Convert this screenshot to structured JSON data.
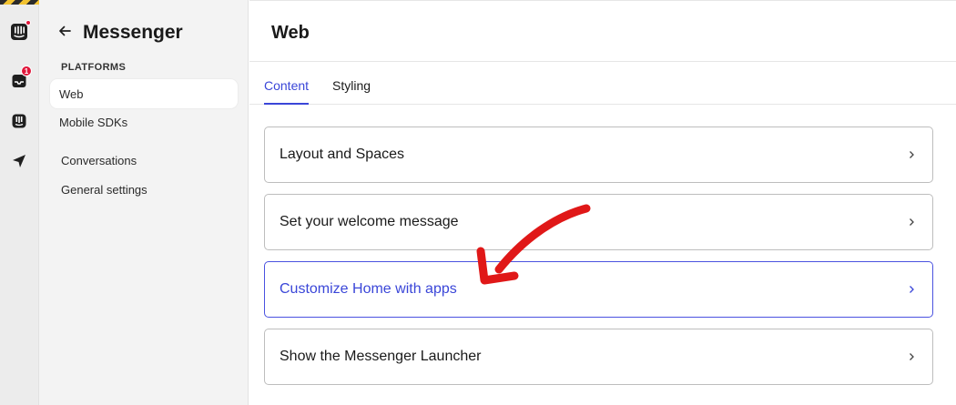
{
  "app": {
    "brand_icon": "intercom-logo-icon"
  },
  "rail": {
    "icons": [
      "intercom-logo-icon",
      "inbox-icon",
      "bot-icon",
      "send-icon"
    ],
    "inbox_badge": "1"
  },
  "sidebar": {
    "title": "Messenger",
    "section_label": "PLATFORMS",
    "platforms": [
      {
        "label": "Web",
        "active": true
      },
      {
        "label": "Mobile SDKs",
        "active": false
      }
    ],
    "items": [
      {
        "label": "Conversations"
      },
      {
        "label": "General settings"
      }
    ]
  },
  "main": {
    "title": "Web",
    "tabs": [
      {
        "label": "Content",
        "active": true
      },
      {
        "label": "Styling",
        "active": false
      }
    ],
    "cards": [
      {
        "label": "Layout and Spaces"
      },
      {
        "label": "Set your welcome message"
      },
      {
        "label": "Customize Home with apps",
        "highlighted": true
      },
      {
        "label": "Show the Messenger Launcher"
      }
    ]
  },
  "colors": {
    "accent": "#3a46d8",
    "badge": "#e0163a",
    "annotation_arrow": "#e01818"
  }
}
